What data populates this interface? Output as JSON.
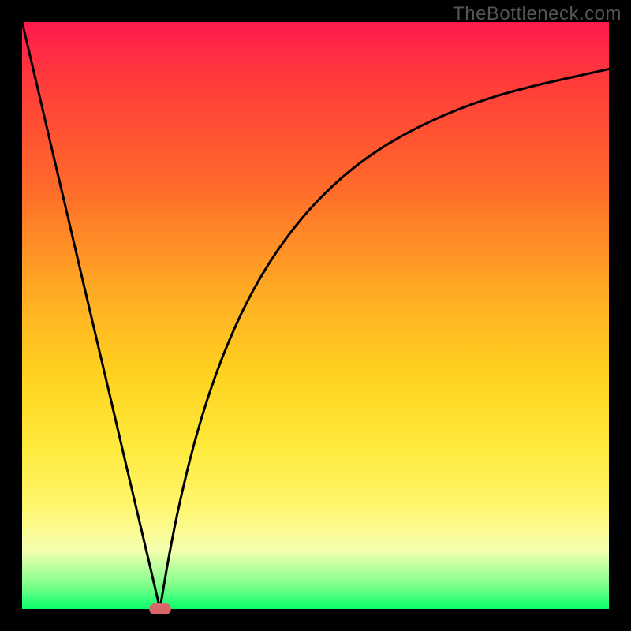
{
  "watermark": {
    "text": "TheBottleneck.com"
  },
  "colors": {
    "background": "#000000",
    "curve": "#000000",
    "marker": "#d8666a",
    "gradient_top": "#ff1a4d",
    "gradient_bottom": "#0aff6b"
  },
  "chart_data": {
    "type": "line",
    "title": "",
    "xlabel": "",
    "ylabel": "",
    "xlim": [
      0,
      100
    ],
    "ylim": [
      0,
      100
    ],
    "grid": false,
    "legend": false,
    "notes": "No axes, ticks, or labels are shown. A rainbow vertical gradient (red→green) fills the plot area. Two black curves descend from the top edge: a nearly-straight left branch from top-left and a concave right branch from upper-right. They meet at a cusp near the bottom. A small rounded red marker sits at the cusp on the baseline.",
    "background_gradient": {
      "direction": "vertical",
      "stops": [
        {
          "pos": 0.0,
          "color": "#ff1a4d"
        },
        {
          "pos": 0.1,
          "color": "#ff3b3b"
        },
        {
          "pos": 0.28,
          "color": "#ff6a2a"
        },
        {
          "pos": 0.45,
          "color": "#ffa824"
        },
        {
          "pos": 0.6,
          "color": "#ffd21f"
        },
        {
          "pos": 0.72,
          "color": "#ffe93a"
        },
        {
          "pos": 0.82,
          "color": "#fff56a"
        },
        {
          "pos": 0.9,
          "color": "#f6ffb0"
        },
        {
          "pos": 0.96,
          "color": "#7dff8a"
        },
        {
          "pos": 1.0,
          "color": "#0aff6b"
        }
      ]
    },
    "series": [
      {
        "name": "left-branch",
        "x": [
          0.0,
          2.5,
          5.0,
          7.5,
          10.0,
          12.5,
          15.0,
          17.5,
          20.0,
          22.0,
          23.5
        ],
        "y": [
          100.0,
          89.4,
          78.7,
          68.1,
          57.4,
          46.8,
          36.2,
          25.5,
          14.9,
          6.4,
          0.0
        ]
      },
      {
        "name": "right-branch",
        "x": [
          23.5,
          25.0,
          27.0,
          30.0,
          34.0,
          39.0,
          45.0,
          52.0,
          60.0,
          70.0,
          82.0,
          100.0
        ],
        "y": [
          0.0,
          9.0,
          19.0,
          31.0,
          43.0,
          54.0,
          63.5,
          71.5,
          78.0,
          83.5,
          88.0,
          92.0
        ]
      }
    ],
    "marker": {
      "x": 23.5,
      "y": 0.0,
      "shape": "rounded-rect",
      "color": "#d8666a"
    }
  }
}
